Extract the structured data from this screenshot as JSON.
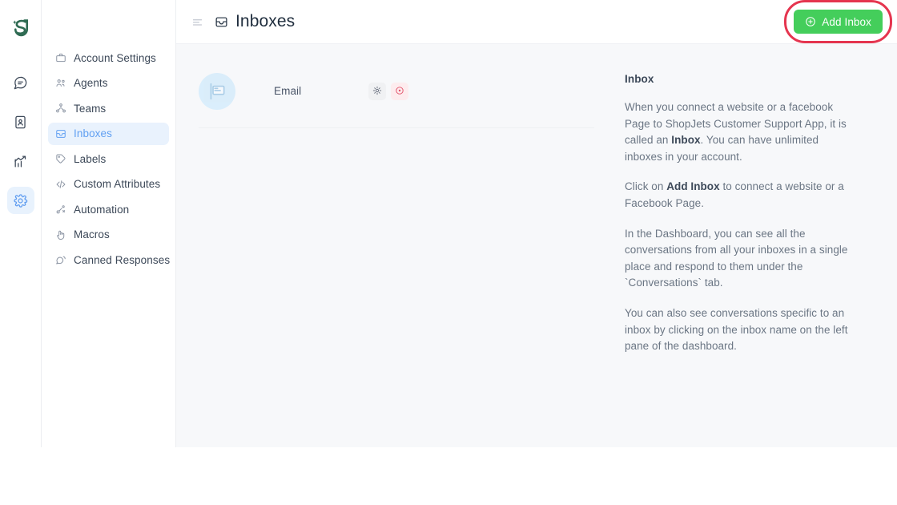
{
  "colors": {
    "brand_green": "#44CE5B",
    "accent_blue": "#61A0F2",
    "active_bg": "#E9F2FD",
    "annotation_red": "#E5354F",
    "delete_red": "#E2526A",
    "page_bg": "#F7F8FA",
    "logo_green": "#2F6B53"
  },
  "rail": {
    "logo_name": "shopjets-logo",
    "items": [
      {
        "icon": "chat-bubble-icon",
        "name": "conversations",
        "active": false
      },
      {
        "icon": "contact-book-icon",
        "name": "contacts",
        "active": false
      },
      {
        "icon": "analytics-chart-icon",
        "name": "reports",
        "active": false
      },
      {
        "icon": "gear-icon",
        "name": "settings",
        "active": true
      }
    ]
  },
  "sidebar": {
    "items": [
      {
        "label": "Account Settings",
        "icon": "briefcase-icon",
        "active": false
      },
      {
        "label": "Agents",
        "icon": "agents-icon",
        "active": false
      },
      {
        "label": "Teams",
        "icon": "teams-icon",
        "active": false
      },
      {
        "label": "Inboxes",
        "icon": "inbox-icon",
        "active": true
      },
      {
        "label": "Labels",
        "icon": "label-tag-icon",
        "active": false
      },
      {
        "label": "Custom Attributes",
        "icon": "code-brackets-icon",
        "active": false
      },
      {
        "label": "Automation",
        "icon": "automation-icon",
        "active": false
      },
      {
        "label": "Macros",
        "icon": "macros-icon",
        "active": false
      },
      {
        "label": "Canned Responses",
        "icon": "canned-responses-icon",
        "active": false
      }
    ]
  },
  "header": {
    "menu_toggle_icon": "hamburger-icon",
    "page_icon": "inbox-icon",
    "title": "Inboxes",
    "add_button_label": "Add Inbox",
    "add_button_icon": "plus-circle-icon",
    "annotation": "red-highlight-ring"
  },
  "inbox_list": {
    "rows": [
      {
        "avatar_icon": "mailbox-icon",
        "name": "",
        "name_redacted": true,
        "channel": "Email",
        "settings_icon": "gear-icon",
        "delete_icon": "delete-circle-icon"
      }
    ]
  },
  "help_panel": {
    "title": "Inbox",
    "paragraphs": [
      {
        "parts": [
          {
            "text": "When you connect a website or a facebook Page to ShopJets Customer Support App, it is called an ",
            "bold": false
          },
          {
            "text": "Inbox",
            "bold": true
          },
          {
            "text": ". You can have unlimited inboxes in your account.",
            "bold": false
          }
        ]
      },
      {
        "parts": [
          {
            "text": "Click on ",
            "bold": false
          },
          {
            "text": "Add Inbox",
            "bold": true
          },
          {
            "text": " to connect a website or a Facebook Page.",
            "bold": false
          }
        ]
      },
      {
        "parts": [
          {
            "text": "In the Dashboard, you can see all the conversations from all your inboxes in a single place and respond to them under the `Conversations` tab.",
            "bold": false
          }
        ]
      },
      {
        "parts": [
          {
            "text": "You can also see conversations specific to an inbox by clicking on the inbox name on the left pane of the dashboard.",
            "bold": false
          }
        ]
      }
    ]
  }
}
